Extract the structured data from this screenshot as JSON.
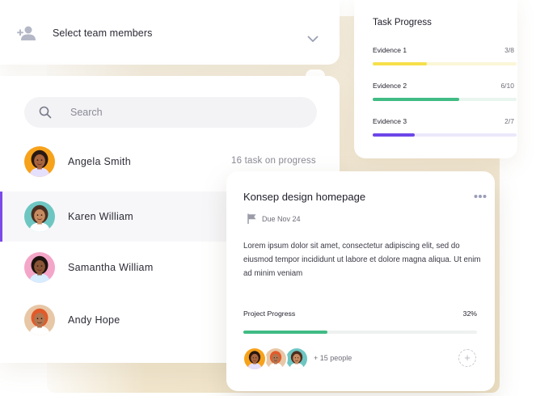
{
  "select_team": {
    "label": "Select team members",
    "icon": "person-add-icon"
  },
  "search": {
    "placeholder": "Search"
  },
  "members": [
    {
      "name": "Angela Smith",
      "meta": "16 task on progress",
      "active": false,
      "avatar_bg": "#f7a21b",
      "skin": "#a8643d",
      "hair": "#2a1812",
      "shirt": "#e6e0ff"
    },
    {
      "name": "Karen William",
      "meta": "",
      "active": true,
      "avatar_bg": "#6ec6c2",
      "skin": "#c78a5f",
      "hair": "#4b2e20",
      "shirt": "#ffffff"
    },
    {
      "name": "Samantha William",
      "meta": "",
      "active": false,
      "avatar_bg": "#f4a6c8",
      "skin": "#8a5436",
      "hair": "#1c120e",
      "shirt": "#d7ecff"
    },
    {
      "name": "Andy Hope",
      "meta": "",
      "active": false,
      "avatar_bg": "#e7c7a6",
      "skin": "#b07650",
      "hair": "#e25a2a",
      "shirt": "#ffffff"
    }
  ],
  "task_progress": {
    "title": "Task Progress",
    "items": [
      {
        "label": "Evidence 1",
        "count": "3/8",
        "fraction": 0.375,
        "color": "#f6e04a",
        "track": "#fbf6d6"
      },
      {
        "label": "Evidence 2",
        "count": "6/10",
        "fraction": 0.6,
        "color": "#40bc84",
        "track": "#e9f5ef"
      },
      {
        "label": "Evidence 3",
        "count": "2/7",
        "fraction": 0.29,
        "color": "#6d46e8",
        "track": "#ece8fb"
      }
    ]
  },
  "task_detail": {
    "title": "Konsep design homepage",
    "due": "Due Nov 24",
    "description": "Lorem ipsum dolor sit amet, consectetur adipiscing elit, sed do eiusmod tempor incididunt ut labore et dolore magna aliqua. Ut enim ad minim veniam",
    "progress_label": "Project Progress",
    "progress_value": "32%",
    "progress_fraction": 0.36,
    "people": "+ 15 people",
    "add_symbol": "+"
  },
  "colors": {
    "accent": "#7b4bea",
    "green": "#40bc84"
  }
}
